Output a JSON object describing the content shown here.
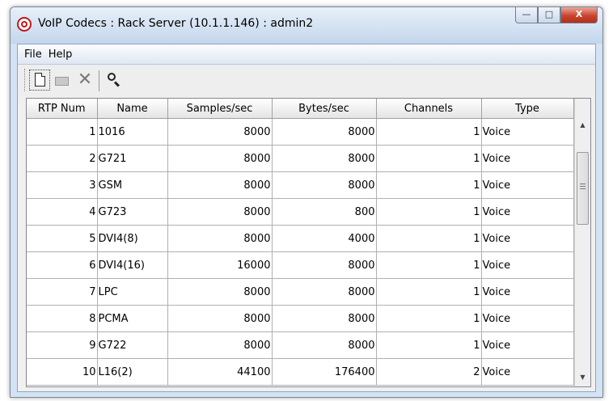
{
  "window": {
    "title": "VoIP Codecs : Rack Server (10.1.1.146) : admin2",
    "controls": {
      "minimize": "—",
      "maximize": "□",
      "close": "X"
    }
  },
  "menu": [
    "File",
    "Help"
  ],
  "toolbar": {
    "icons": [
      "new-icon",
      "open-icon",
      "delete-icon",
      "search-icon"
    ]
  },
  "table": {
    "columns": [
      "RTP Num",
      "Name",
      "Samples/sec",
      "Bytes/sec",
      "Channels",
      "Type"
    ],
    "rows": [
      [
        "1",
        "1016",
        "8000",
        "8000",
        "1",
        "Voice"
      ],
      [
        "2",
        "G721",
        "8000",
        "8000",
        "1",
        "Voice"
      ],
      [
        "3",
        "GSM",
        "8000",
        "8000",
        "1",
        "Voice"
      ],
      [
        "4",
        "G723",
        "8000",
        "800",
        "1",
        "Voice"
      ],
      [
        "5",
        "DVI4(8)",
        "8000",
        "4000",
        "1",
        "Voice"
      ],
      [
        "6",
        "DVI4(16)",
        "16000",
        "8000",
        "1",
        "Voice"
      ],
      [
        "7",
        "LPC",
        "8000",
        "8000",
        "1",
        "Voice"
      ],
      [
        "8",
        "PCMA",
        "8000",
        "8000",
        "1",
        "Voice"
      ],
      [
        "9",
        "G722",
        "8000",
        "8000",
        "1",
        "Voice"
      ],
      [
        "10",
        "L16(2)",
        "44100",
        "176400",
        "2",
        "Voice"
      ]
    ]
  }
}
